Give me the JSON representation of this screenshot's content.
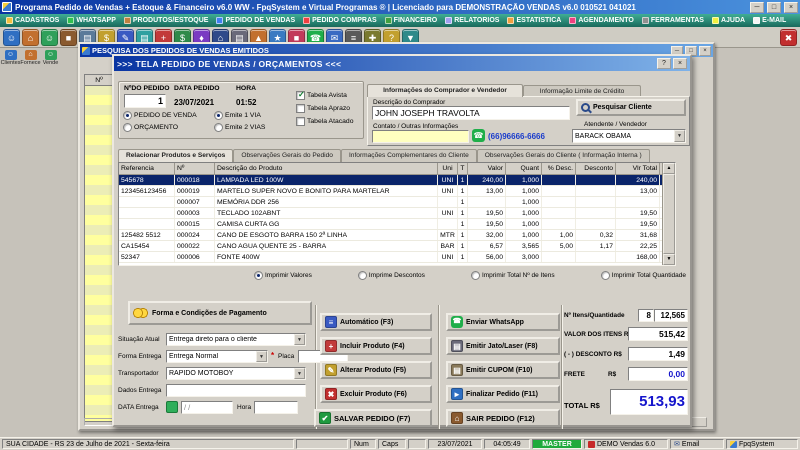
{
  "colors": {
    "title_blue": "#0a35a2",
    "selection_blue": "#0a246a",
    "whatsapp_green": "#1fae4a",
    "master_green": "#1faa3c",
    "total_blue": "#1515cc",
    "input_yellow": "#ffffc0"
  },
  "icons": {
    "minimize": "─",
    "maximize": "□",
    "close": "×",
    "help": "?",
    "dropdown": "▼",
    "up": "▲",
    "down": "▼",
    "whatsapp": "☎",
    "printer": "▤",
    "save_check": "✔",
    "delete_cross": "✖",
    "add_plus": "+",
    "edit_pencil": "✎",
    "auto": "≡",
    "door": "⌂",
    "finish": "►",
    "mail": "✉"
  },
  "app": {
    "title": "Programa Pedido de Vendas + Estoque & Financeiro v6.0 WW - FpqSystem e Virtual Programas ®  |  Licenciado para  DEMONSTRAÇÃO VENDAS v6.0 010521 041021",
    "menu": [
      {
        "label": "CADASTROS",
        "color": "#f0c040"
      },
      {
        "label": "WHATSAPP",
        "color": "#30c050"
      },
      {
        "label": "PRODUTOS/ESTOQUE",
        "color": "#c08040"
      },
      {
        "label": "PEDIDO DE VENDAS",
        "color": "#4080f0"
      },
      {
        "label": "PEDIDO COMPRAS",
        "color": "#f04040"
      },
      {
        "label": "FINANCEIRO",
        "color": "#40a040"
      },
      {
        "label": "RELATORIOS",
        "color": "#a0a0f0"
      },
      {
        "label": "ESTATISTICA",
        "color": "#f0a040"
      },
      {
        "label": "AGENDAMENTO",
        "color": "#f04080"
      },
      {
        "label": "FERRAMENTAS",
        "color": "#909090"
      },
      {
        "label": "AJUDA",
        "color": "#f0f040"
      },
      {
        "label": "E-MAIL",
        "color": "#f5f5f5"
      }
    ],
    "toolbar_icons": [
      {
        "name": "clientes-icon",
        "glyph": "☺",
        "color": "#2f6fc2"
      },
      {
        "name": "fornecedores-icon",
        "glyph": "⌂",
        "color": "#c2702f"
      },
      {
        "name": "vendedores-icon",
        "glyph": "☺",
        "color": "#2fa05a"
      },
      {
        "name": "produtos-icon",
        "glyph": "■",
        "color": "#8a5a2f"
      },
      {
        "name": "estoque-icon",
        "glyph": "▤",
        "color": "#5a7a9a"
      },
      {
        "name": "tabela-precos-icon",
        "glyph": "$",
        "color": "#c2a02f"
      },
      {
        "name": "pedido-venda-icon",
        "glyph": "✎",
        "color": "#3a5ac2"
      },
      {
        "name": "orcamento-icon",
        "glyph": "▤",
        "color": "#2fa0a0"
      },
      {
        "name": "pedido-compra-icon",
        "glyph": "+",
        "color": "#c23a3a"
      },
      {
        "name": "financeiro-icon",
        "glyph": "$",
        "color": "#2f8a4a"
      },
      {
        "name": "caixa-icon",
        "glyph": "♦",
        "color": "#7a3ac2"
      },
      {
        "name": "banco-icon",
        "glyph": "⌂",
        "color": "#2f4a8a"
      },
      {
        "name": "relatorios-icon",
        "glyph": "▤",
        "color": "#6a6a7a"
      },
      {
        "name": "graficos-icon",
        "glyph": "▲",
        "color": "#c2702f"
      },
      {
        "name": "estatistica-icon",
        "glyph": "★",
        "color": "#3a7ac2"
      },
      {
        "name": "agenda-icon",
        "glyph": "■",
        "color": "#c23a5a"
      },
      {
        "name": "whatsapp-icon",
        "glyph": "☎",
        "color": "#1fae4a"
      },
      {
        "name": "email-icon",
        "glyph": "✉",
        "color": "#3a6ac2"
      },
      {
        "name": "calculadora-icon",
        "glyph": "≡",
        "color": "#5a5a5a"
      },
      {
        "name": "ferramentas-icon",
        "glyph": "✚",
        "color": "#7a7a2f"
      },
      {
        "name": "ajuda-icon",
        "glyph": "?",
        "color": "#c2a02f"
      },
      {
        "name": "backup-icon",
        "glyph": "▼",
        "color": "#2f8a8a"
      },
      {
        "name": "sair-icon",
        "glyph": "✖",
        "color": "#c22f2f"
      }
    ],
    "side_buttons": [
      {
        "label": "Clientes",
        "glyph": "☺",
        "color": "#2f6fc2"
      },
      {
        "label": "Fornece",
        "glyph": "⌂",
        "color": "#c2702f"
      },
      {
        "label": "Vende",
        "glyph": "☺",
        "color": "#2fa05a"
      }
    ]
  },
  "search_window": {
    "title": "PESQUISA DOS PEDIDOS DE VENDAS EMITIDOS",
    "col_no": "Nº"
  },
  "order_dialog": {
    "title": ">>>   TELA PEDIDO DE VENDAS / ORÇAMENTOS   <<<",
    "fields": {
      "numero_label": "NºDO PEDIDO",
      "numero": "1",
      "data_label": "DATA PEDIDO",
      "data": "23/07/2021",
      "hora_label": "HORA",
      "hora": "01:52"
    },
    "type_options": [
      "PEDIDO DE VENDA",
      "ORÇAMENTO"
    ],
    "via_options": [
      "Emite 1 VIA",
      "Emite 2 VIAS"
    ],
    "tabelas": [
      "Tabela Avista",
      "Tabela Aprazo",
      "Tabela Atacado"
    ],
    "buyer_tabs": [
      "Informações do Comprador e Vendedor",
      "Informação Limite de Crédito"
    ],
    "buyer": {
      "descricao_label": "Descrição do Comprador",
      "nome": "JOHN JOSEPH TRAVOLTA",
      "contato_label": "Contato / Outras Informações",
      "telefone": "(66)96666-6666",
      "pesquisar_button": "Pesquisar Cliente",
      "vendedor_label": "Atendente / Vendedor",
      "vendedor": "BARACK OBAMA"
    },
    "product_tabs": [
      "Relacionar Produtos e Serviços",
      "Observações Gerais do Pedido",
      "Informações Complementares do Cliente",
      "Observações Gerais do Cliente ( Informação Interna )"
    ],
    "table": {
      "columns": [
        "Referencia",
        "Nº",
        "Descrição do Produto",
        "Uni",
        "T",
        "Valor",
        "Quant",
        "% Desc.",
        "Desconto",
        "Vlr Total"
      ],
      "rows": [
        {
          "ref": "545678",
          "num": "000018",
          "desc": "LAMPADA LED 100W",
          "uni": "UNI",
          "t": "1",
          "valor": "240,00",
          "quant": "1,000",
          "pdesc": "",
          "desc_val": "",
          "total": "240,00"
        },
        {
          "ref": "123456123456",
          "num": "000019",
          "desc": "MARTELO SUPER NOVO E BONITO PARA MARTELAR",
          "uni": "UNI",
          "t": "1",
          "valor": "13,00",
          "quant": "1,000",
          "pdesc": "",
          "desc_val": "",
          "total": "13,00"
        },
        {
          "ref": "",
          "num": "000007",
          "desc": "MEMÓRIA DDR 256",
          "uni": "",
          "t": "1",
          "valor": "",
          "quant": "1,000",
          "pdesc": "",
          "desc_val": "",
          "total": ""
        },
        {
          "ref": "",
          "num": "000003",
          "desc": "TECLADO 102ABNT",
          "uni": "UNI",
          "t": "1",
          "valor": "19,50",
          "quant": "1,000",
          "pdesc": "",
          "desc_val": "",
          "total": "19,50"
        },
        {
          "ref": "",
          "num": "000015",
          "desc": "CAMISA CURTA GG",
          "uni": "",
          "t": "1",
          "valor": "19,50",
          "quant": "1,000",
          "pdesc": "",
          "desc_val": "",
          "total": "19,50"
        },
        {
          "ref": "125482 5512",
          "num": "000024",
          "desc": "CANO DE ESGOTO BARRA 150 2ª LINHA",
          "uni": "MTR",
          "t": "1",
          "valor": "32,00",
          "quant": "1,000",
          "pdesc": "1,00",
          "desc_val": "0,32",
          "total": "31,68"
        },
        {
          "ref": "CA15454",
          "num": "000022",
          "desc": "CANO AGUA QUENTE 25 - BARRA",
          "uni": "BAR",
          "t": "1",
          "valor": "6,57",
          "quant": "3,565",
          "pdesc": "5,00",
          "desc_val": "1,17",
          "total": "22,25"
        },
        {
          "ref": "52347",
          "num": "000006",
          "desc": "FONTE 400W",
          "uni": "UNI",
          "t": "1",
          "valor": "56,00",
          "quant": "3,000",
          "pdesc": "",
          "desc_val": "",
          "total": "168,00"
        }
      ]
    },
    "print_options": [
      "Imprimir Valores",
      "Imprime Descontos",
      "Imprimir Total Nº de Itens",
      "Imprimir Total Quantidade"
    ],
    "payment_button": "Forma e Condições de Pagamento",
    "delivery": {
      "situacao_label": "Situação Atual",
      "situacao": "Entrega direto para o cliente",
      "forma_label": "Forma Entrega",
      "forma": "Entrega Normal",
      "required_mark": "*",
      "placa_label": "Placa",
      "transportador_label": "Transportador",
      "transportador": "RAPIDO MOTOBOY",
      "dados_label": "Dados Entrega",
      "data_label": "DATA Entrega",
      "data_mask": "/  /",
      "hora_label": "Hora"
    },
    "buttons": {
      "automatico": "Automático   (F3)",
      "incluir": "Incluir Produto  (F4)",
      "alterar": "Alterar Produto  (F5)",
      "excluir": "Excluir Produto  (F6)",
      "salvar": "SALVAR PEDIDO (F7)",
      "whatsapp": "Enviar WhatsApp",
      "jato": "Emitir Jato/Laser  (F8)",
      "cupom": "Emitir CUPOM  (F10)",
      "finalizar": "Finalizar Pedido  (F11)",
      "sair": "SAIR  PEDIDO  (F12)"
    },
    "totals": {
      "itens_label": "Nº Itens/Quantidade",
      "itens": "8",
      "quantidade": "12,565",
      "valor_label": "VALOR DOS ITENS  R$",
      "valor": "515,42",
      "desconto_label": "( - ) DESCONTO R$",
      "desconto": "1,49",
      "frete_label": "FRETE",
      "frete_moeda": "R$",
      "frete": "0,00",
      "total_label": "TOTAL R$",
      "total": "513,93"
    }
  },
  "statusbar": {
    "location": "SUA CIDADE - RS 23 de Julho de 2021 - Sexta-feira",
    "num": "Num",
    "caps": "Caps",
    "date": "23/07/2021",
    "time": "04:05:49",
    "master": "MASTER",
    "demo": "DEMO Vendas 6.0",
    "email": "Email",
    "brand": "FpqSystem"
  }
}
